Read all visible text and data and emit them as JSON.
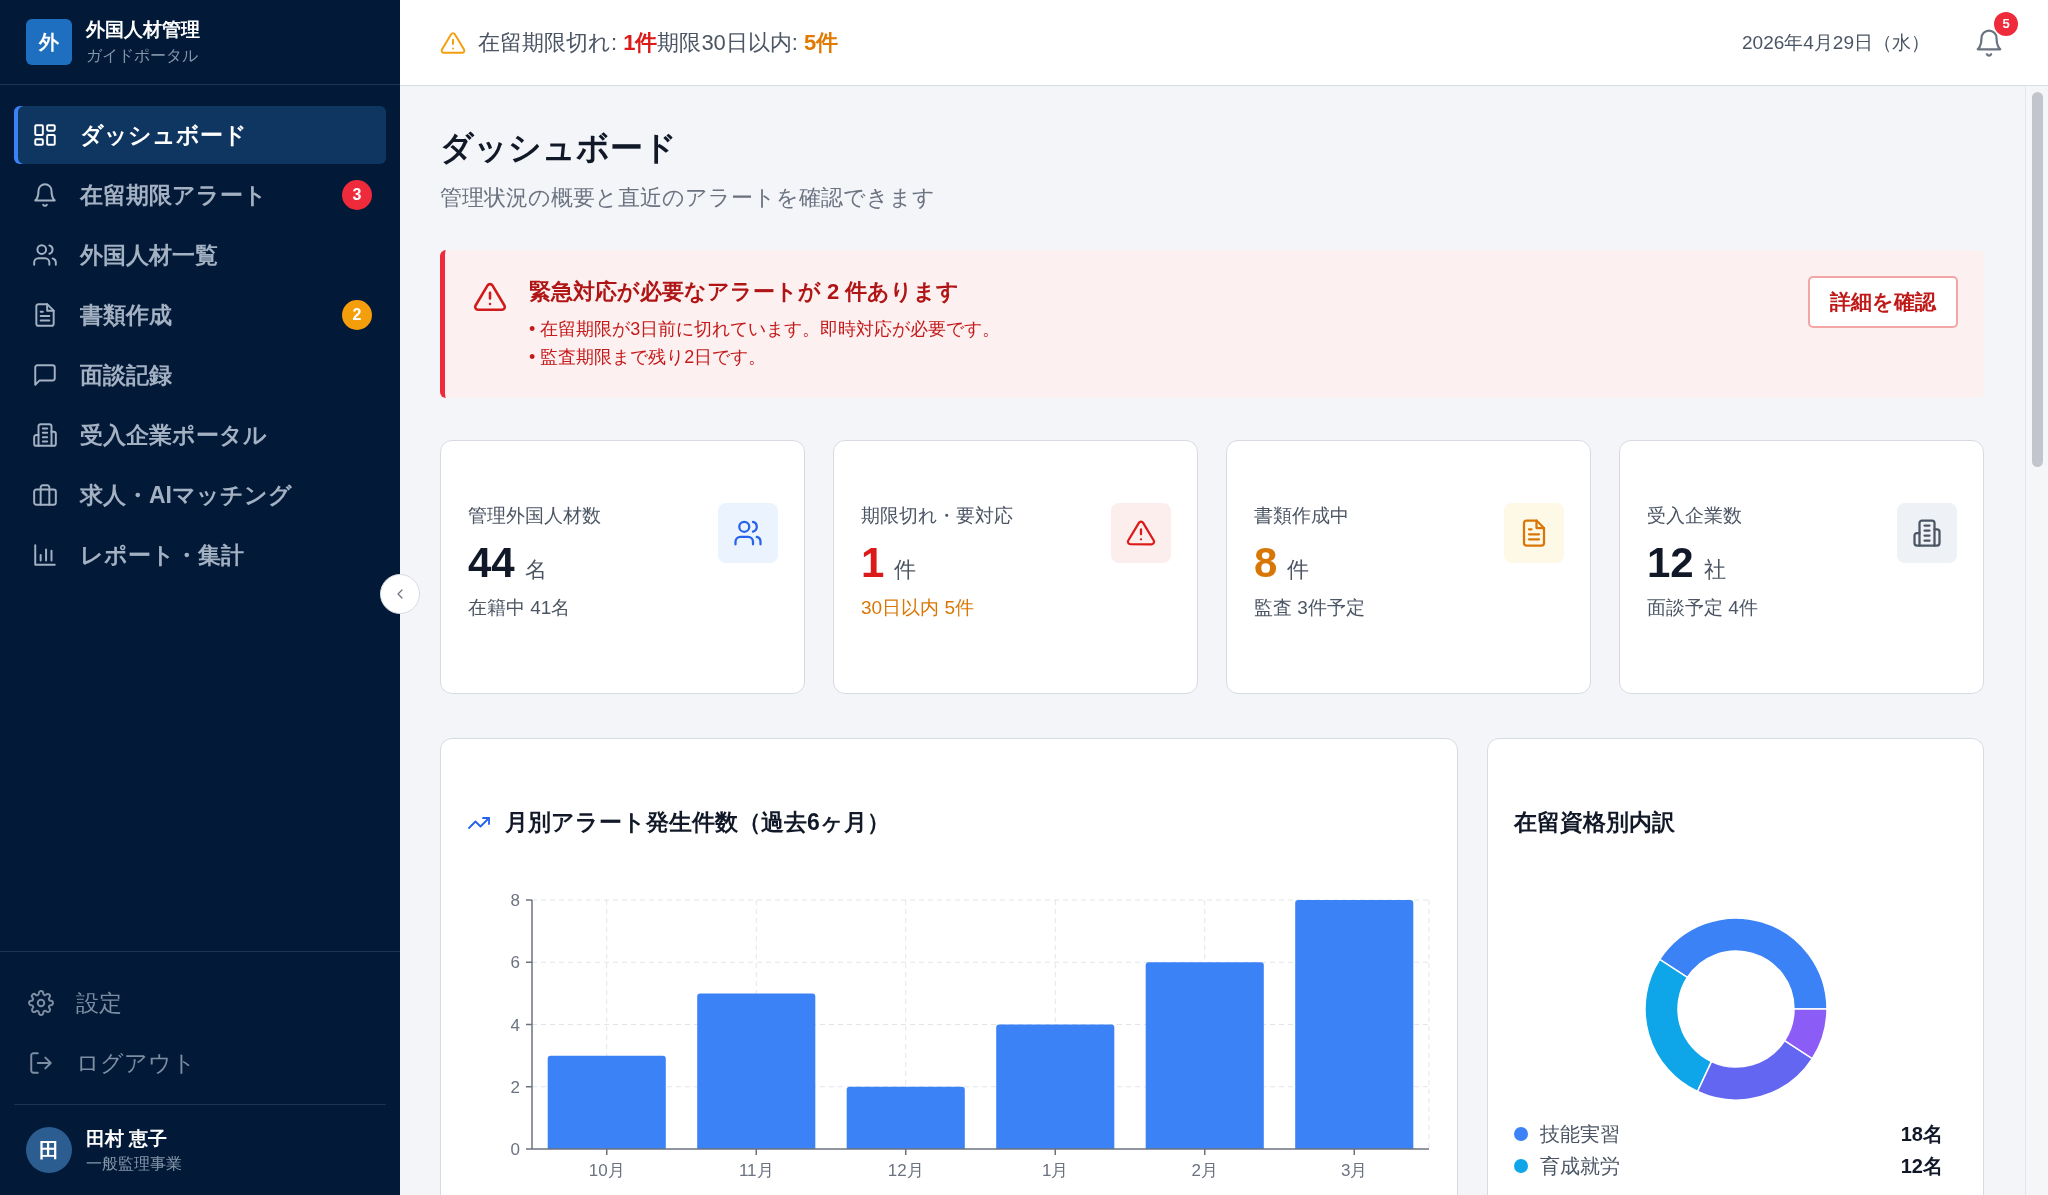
{
  "sidebar": {
    "logo": "外",
    "title": "外国人材管理",
    "subtitle": "ガイドポータル",
    "items": [
      {
        "label": "ダッシュボード",
        "selected": true
      },
      {
        "label": "在留期限アラート",
        "selected": false,
        "badge": "3",
        "color": "#ef2b3b"
      },
      {
        "label": "外国人材一覧",
        "selected": false
      },
      {
        "label": "書類作成",
        "selected": false,
        "badge": "2",
        "color": "#f59e0b"
      },
      {
        "label": "面談記録",
        "selected": false
      },
      {
        "label": "受入企業ポータル",
        "selected": false
      },
      {
        "label": "求人・AIマッチング",
        "selected": false
      },
      {
        "label": "レポート・集計",
        "selected": false
      }
    ],
    "footer_items": [
      {
        "label": "設定"
      },
      {
        "label": "ログアウト"
      }
    ],
    "user": {
      "avatar": "田",
      "name": "田村 恵子",
      "role": "一般監理事業"
    }
  },
  "header": {
    "status": [
      {
        "label": "在留期限切れ:",
        "count": "1件",
        "color": "#dc1a1a"
      },
      {
        "label": "期限30日以内:",
        "count": "5件",
        "color": "#e07a00"
      }
    ],
    "date": "2026年4月29日（水）",
    "notifications": "5"
  },
  "page": {
    "title": "ダッシュボード",
    "subtitle": "管理状況の概要と直近のアラートを確認できます"
  },
  "alert": {
    "title": "緊急対応が必要なアラートが 2 件あります",
    "lines": [
      "• 在留期限が3日前に切れています。即時対応が必要です。",
      "• 監査期限まで残り2日です。"
    ],
    "button": "詳細を確認"
  },
  "cards": [
    {
      "label": "管理外国人材数",
      "value": "44",
      "unit": "名",
      "sub": "在籍中 41名"
    },
    {
      "label": "期限切れ・要対応",
      "value": "1",
      "unit": "件",
      "sub": "30日以内 5件"
    },
    {
      "label": "書類作成中",
      "value": "8",
      "unit": "件",
      "sub": "監査 3件予定"
    },
    {
      "label": "受入企業数",
      "value": "12",
      "unit": "社",
      "sub": "面談予定 4件"
    }
  ],
  "bar_panel": {
    "title": "月別アラート発生件数（過去6ヶ月）",
    "chart_data": {
      "type": "bar",
      "categories": [
        "10月",
        "11月",
        "12月",
        "1月",
        "2月",
        "3月"
      ],
      "series": [
        {
          "color": "#3b82f6",
          "values": [
            3,
            5,
            2,
            4,
            6,
            8
          ]
        }
      ],
      "ylim": [
        0,
        8
      ],
      "yticks": [
        0,
        2,
        4,
        6,
        8
      ],
      "grid": true
    }
  },
  "donut_panel": {
    "title": "在留資格別内訳",
    "legend": [
      {
        "label": "技能実習",
        "value": "18名",
        "color": "#3b82f6"
      },
      {
        "label": "育成就労",
        "value": "12名",
        "color": "#0ea5e9"
      }
    ]
  }
}
